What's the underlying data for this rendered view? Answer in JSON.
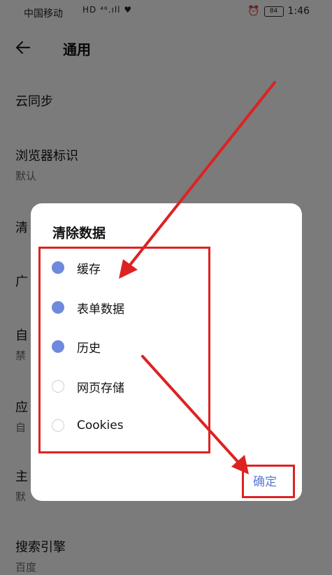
{
  "status_bar": {
    "carrier": "中国移动",
    "signal_icons": "HD ⁴⁶.ıll ♥",
    "battery": "84",
    "time": "1:46"
  },
  "header": {
    "title": "通用"
  },
  "settings": [
    {
      "title": "云同步",
      "subtitle": ""
    },
    {
      "title": "浏览器标识",
      "subtitle": "默认"
    },
    {
      "title": "清",
      "subtitle": ""
    },
    {
      "title": "广",
      "subtitle": ""
    },
    {
      "title": "自",
      "subtitle": "禁"
    },
    {
      "title": "应",
      "subtitle": "自"
    },
    {
      "title": "主",
      "subtitle": "默"
    },
    {
      "title": "搜索引擎",
      "subtitle": "百度"
    }
  ],
  "dialog": {
    "title": "清除数据",
    "options": [
      {
        "label": "缓存",
        "checked": true
      },
      {
        "label": "表单数据",
        "checked": true
      },
      {
        "label": "历史",
        "checked": true
      },
      {
        "label": "网页存储",
        "checked": false
      },
      {
        "label": "Cookies",
        "checked": false
      }
    ],
    "confirm": "确定"
  },
  "colors": {
    "radio_on": "#6f89dd",
    "confirm": "#5b78d6",
    "annotation_red": "#dd2222"
  }
}
